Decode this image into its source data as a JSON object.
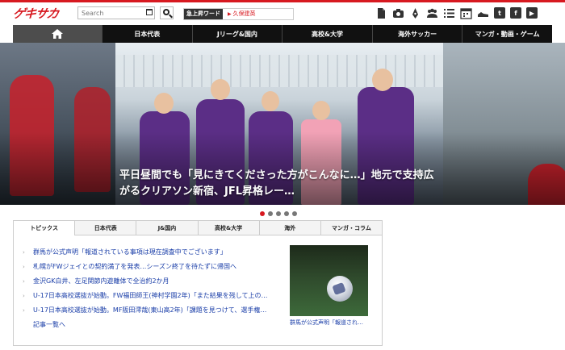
{
  "brand": {
    "logo": "ゲキサカ",
    "accent": "#d71920"
  },
  "search": {
    "placeholder": "Search"
  },
  "trending": {
    "label": "急上昇ワード",
    "value": "久保建英"
  },
  "header_icons": [
    "document-icon",
    "camera-icon",
    "pen-icon",
    "group-icon",
    "list-icon",
    "calendar-icon",
    "shoe-icon",
    "twitter-icon",
    "facebook-icon",
    "youtube-icon"
  ],
  "nav": {
    "home_icon": "home-icon",
    "items": [
      "日本代表",
      "Jリーグ&国内",
      "高校&大学",
      "海外サッカー",
      "マンガ・動画・ゲーム"
    ]
  },
  "hero": {
    "caption": "平日昼間でも「見にきてくださった方がこんなに…」地元で支持広がるクリアソン新宿、JFL昇格レー…",
    "slide_count": 5,
    "active_slide": 1
  },
  "news": {
    "tabs": [
      "トピックス",
      "日本代表",
      "J&国内",
      "高校&大学",
      "海外",
      "マンガ・コラム"
    ],
    "active_tab": 0,
    "items": [
      "群馬が公式声明「報道されている事項は現在調査中でございます」",
      "札幌がFWジェイとの契約満了を発表…シーズン終了を待たずに帰国へ",
      "金沢GK白井、左足関節内遊離体で全治約2か月",
      "U-17日本高校選抜が始動。FW福田師王(神村学園2年)「また結果を残して上の…",
      "U-17日本高校選抜が始動。MF阪田澪哉(東山高2年)「課題を見つけて、選手権…"
    ],
    "more": "記事一覧へ",
    "thumb_caption": "群馬が公式声明「報道され…"
  }
}
